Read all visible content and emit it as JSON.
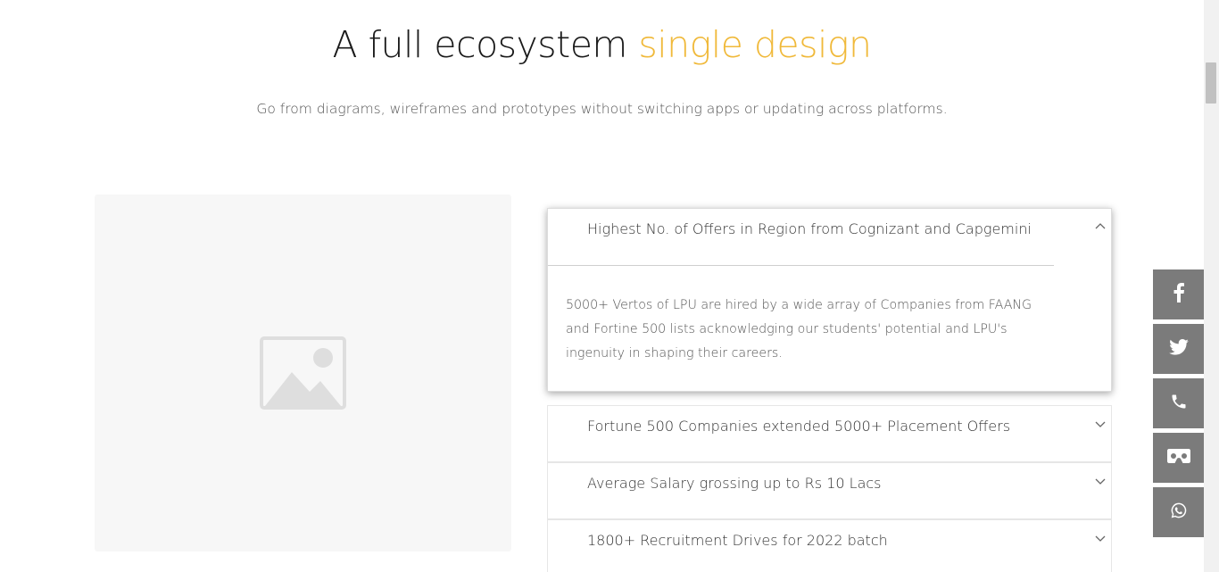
{
  "section": {
    "heading_main": "A full ecosystem",
    "heading_accent": "single design",
    "subheading": "Go from diagrams, wireframes and prototypes without switching apps or updating across platforms."
  },
  "image_panel": {
    "icon": "image-placeholder-icon"
  },
  "accordion": {
    "items": [
      {
        "title": "Highest No. of Offers in Region from Cognizant and Capgemini",
        "expanded": true,
        "body": "5000+ Vertos of LPU are hired by a wide array of Companies from FAANG and Fortine 500 lists acknowledging our students' potential and LPU's ingenuity in shaping their careers."
      },
      {
        "title": "Fortune 500 Companies extended 5000+ Placement Offers",
        "expanded": false
      },
      {
        "title": "Average Salary grossing up to Rs 10 Lacs",
        "expanded": false
      },
      {
        "title": "1800+ Recruitment Drives for 2022 batch",
        "expanded": false
      }
    ]
  },
  "social_bar": {
    "buttons": [
      "facebook-icon",
      "twitter-icon",
      "phone-icon",
      "vr-headset-icon",
      "whatsapp-icon"
    ]
  },
  "colors": {
    "accent": "#f0b93a",
    "social_bg": "#7b7b7b",
    "panel_bg": "#f7f7f7"
  }
}
